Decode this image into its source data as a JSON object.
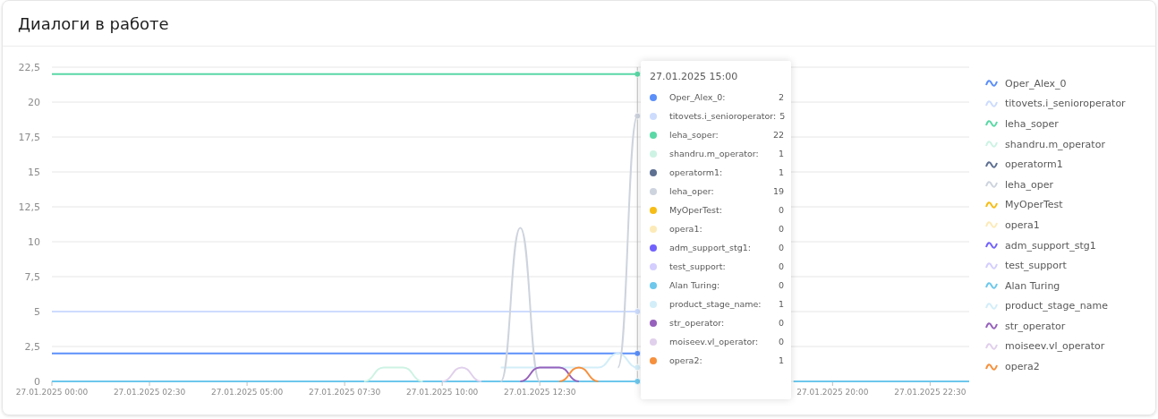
{
  "card": {
    "title": "Диалоги в работе"
  },
  "chart_data": {
    "type": "line",
    "ylim": [
      0,
      22.5
    ],
    "grid": true,
    "legend": true,
    "categories": [
      "27.01.2025 00:00",
      null,
      null,
      null,
      null,
      "27.01.2025 02:30",
      null,
      null,
      null,
      null,
      "27.01.2025 05:00",
      null,
      null,
      null,
      null,
      "27.01.2025 07:30",
      null,
      null,
      null,
      null,
      "27.01.2025 10:00",
      null,
      null,
      null,
      null,
      "27.01.2025 12:30",
      null,
      null,
      null,
      null,
      null,
      null,
      null,
      null,
      null,
      null,
      null,
      null,
      null,
      null,
      "27.01.2025 20:00",
      null,
      null,
      null,
      null,
      "27.01.2025 22:30",
      null,
      null
    ],
    "yticks": [
      {
        "value": 0,
        "label": "0"
      },
      {
        "value": 2.5,
        "label": "2,5"
      },
      {
        "value": 5,
        "label": "5"
      },
      {
        "value": 7.5,
        "label": "7,5"
      },
      {
        "value": 10,
        "label": "10"
      },
      {
        "value": 12.5,
        "label": "12,5"
      },
      {
        "value": 15,
        "label": "15"
      },
      {
        "value": 17.5,
        "label": "17,5"
      },
      {
        "value": 20,
        "label": "20"
      },
      {
        "value": 22.5,
        "label": "22,5"
      }
    ],
    "series": [
      {
        "name": "Oper_Alex_0",
        "color": "#5b8ff9",
        "values": [
          2,
          2,
          2,
          2,
          2,
          2,
          2,
          2,
          2,
          2,
          2,
          2,
          2,
          2,
          2,
          2,
          2,
          2,
          2,
          2,
          2,
          2,
          2,
          2,
          2,
          2,
          2,
          2,
          2,
          2,
          2,
          null,
          null,
          null,
          null,
          null,
          null,
          null,
          null,
          null,
          null,
          null,
          null,
          null,
          null,
          null,
          null,
          null
        ]
      },
      {
        "name": "titovets.i_senioroperator",
        "color": "#cddcfd",
        "values": [
          5,
          5,
          5,
          5,
          5,
          5,
          5,
          5,
          5,
          5,
          5,
          5,
          5,
          5,
          5,
          5,
          5,
          5,
          5,
          5,
          5,
          5,
          5,
          5,
          5,
          5,
          5,
          5,
          5,
          5,
          5,
          null,
          null,
          null,
          null,
          null,
          null,
          null,
          null,
          null,
          null,
          null,
          null,
          null,
          null,
          null,
          null,
          null
        ]
      },
      {
        "name": "leha_soper",
        "color": "#5ad8a6",
        "values": [
          22,
          22,
          22,
          22,
          22,
          22,
          22,
          22,
          22,
          22,
          22,
          22,
          22,
          22,
          22,
          22,
          22,
          22,
          22,
          22,
          22,
          22,
          22,
          22,
          22,
          22,
          22,
          22,
          22,
          22,
          22,
          null,
          null,
          null,
          null,
          null,
          null,
          null,
          null,
          null,
          null,
          null,
          null,
          null,
          null,
          null,
          null,
          null
        ]
      },
      {
        "name": "shandru.m_operator",
        "color": "#cdf3e4",
        "values": [
          null,
          null,
          null,
          null,
          null,
          null,
          null,
          null,
          null,
          null,
          null,
          null,
          null,
          null,
          null,
          null,
          0,
          1,
          1,
          0,
          null,
          null,
          null,
          null,
          null,
          null,
          null,
          null,
          null,
          null,
          null,
          null,
          null,
          null,
          null,
          null,
          null,
          null,
          null,
          null,
          null,
          null,
          null,
          null,
          null,
          null,
          null,
          null
        ]
      },
      {
        "name": "operatorm1",
        "color": "#5d7092",
        "values": [
          null,
          null,
          null,
          null,
          null,
          null,
          null,
          null,
          null,
          null,
          null,
          null,
          null,
          null,
          null,
          null,
          null,
          null,
          null,
          null,
          null,
          null,
          null,
          null,
          null,
          null,
          null,
          null,
          null,
          null,
          null,
          null,
          null,
          null,
          null,
          null,
          null,
          null,
          null,
          null,
          null,
          null,
          null,
          null,
          null,
          null,
          null,
          null
        ]
      },
      {
        "name": "leha_oper",
        "color": "#ced4de",
        "values": [
          null,
          null,
          null,
          null,
          null,
          null,
          null,
          null,
          null,
          null,
          null,
          null,
          null,
          null,
          null,
          null,
          null,
          null,
          null,
          null,
          null,
          null,
          null,
          0,
          11,
          0,
          null,
          null,
          null,
          1,
          19,
          null,
          null,
          null,
          null,
          null,
          null,
          null,
          null,
          null,
          null,
          null,
          null,
          null,
          null,
          null,
          null,
          null
        ]
      },
      {
        "name": "MyOperTest",
        "color": "#f6bd16",
        "values": [
          null,
          null,
          null,
          null,
          null,
          null,
          null,
          null,
          null,
          null,
          null,
          null,
          null,
          null,
          null,
          null,
          null,
          null,
          null,
          null,
          null,
          null,
          null,
          null,
          null,
          null,
          null,
          null,
          null,
          null,
          null,
          null,
          null,
          null,
          null,
          null,
          null,
          null,
          null,
          null,
          null,
          null,
          null,
          null,
          null,
          null,
          null,
          null
        ]
      },
      {
        "name": "opera1",
        "color": "#fcebb9",
        "values": [
          null,
          null,
          null,
          null,
          null,
          null,
          null,
          null,
          null,
          null,
          null,
          null,
          null,
          null,
          null,
          null,
          null,
          null,
          null,
          null,
          null,
          null,
          null,
          null,
          null,
          null,
          null,
          null,
          null,
          null,
          null,
          null,
          null,
          null,
          null,
          null,
          null,
          null,
          null,
          null,
          null,
          null,
          null,
          null,
          null,
          null,
          null,
          null
        ]
      },
      {
        "name": "adm_support_stg1",
        "color": "#7262fd",
        "values": [
          null,
          null,
          null,
          null,
          null,
          null,
          null,
          null,
          null,
          null,
          null,
          null,
          null,
          null,
          null,
          null,
          null,
          null,
          null,
          null,
          null,
          null,
          null,
          null,
          null,
          null,
          null,
          null,
          null,
          null,
          null,
          null,
          null,
          null,
          null,
          null,
          null,
          null,
          null,
          null,
          null,
          null,
          null,
          null,
          null,
          null,
          null,
          null
        ]
      },
      {
        "name": "test_support",
        "color": "#d3cefe",
        "values": [
          null,
          null,
          null,
          null,
          null,
          null,
          null,
          null,
          null,
          null,
          null,
          null,
          null,
          null,
          null,
          null,
          null,
          null,
          null,
          null,
          null,
          null,
          null,
          null,
          null,
          null,
          null,
          null,
          null,
          null,
          null,
          null,
          null,
          null,
          null,
          null,
          null,
          null,
          null,
          null,
          null,
          null,
          null,
          null,
          null,
          null,
          null,
          null
        ]
      },
      {
        "name": "Alan Turing",
        "color": "#6dc8ec",
        "values": [
          0,
          0,
          0,
          0,
          0,
          0,
          0,
          0,
          0,
          0,
          0,
          0,
          0,
          0,
          0,
          0,
          0,
          0,
          0,
          0,
          0,
          0,
          0,
          0,
          0,
          0,
          0,
          0,
          0,
          0,
          0,
          null,
          null,
          null,
          null,
          null,
          null,
          null,
          0,
          0,
          0,
          0,
          0,
          0,
          0,
          0,
          0,
          0
        ]
      },
      {
        "name": "product_stage_name",
        "color": "#d3eef9",
        "values": [
          null,
          null,
          null,
          null,
          null,
          null,
          null,
          null,
          null,
          null,
          null,
          null,
          null,
          null,
          null,
          null,
          null,
          null,
          null,
          null,
          null,
          null,
          null,
          1,
          1,
          1,
          1,
          1,
          1,
          2,
          1,
          null,
          null,
          null,
          null,
          null,
          null,
          null,
          null,
          null,
          null,
          null,
          null,
          null,
          null,
          null,
          null,
          null
        ]
      },
      {
        "name": "str_operator",
        "color": "#9661bc",
        "values": [
          null,
          null,
          null,
          null,
          null,
          null,
          null,
          null,
          null,
          null,
          null,
          null,
          null,
          null,
          null,
          null,
          null,
          null,
          null,
          null,
          null,
          null,
          null,
          null,
          0,
          1,
          1,
          0,
          null,
          null,
          null,
          null,
          null,
          null,
          null,
          null,
          null,
          null,
          null,
          null,
          null,
          null,
          null,
          null,
          null,
          null,
          null,
          null
        ]
      },
      {
        "name": "moiseev.vl_operator",
        "color": "#e0d0ec",
        "values": [
          null,
          null,
          null,
          null,
          null,
          null,
          null,
          null,
          null,
          null,
          null,
          null,
          null,
          null,
          null,
          null,
          null,
          null,
          null,
          null,
          0,
          1,
          0,
          null,
          null,
          null,
          null,
          null,
          null,
          null,
          null,
          null,
          null,
          null,
          null,
          null,
          null,
          null,
          null,
          null,
          null,
          null,
          null,
          null,
          null,
          null,
          null,
          null
        ]
      },
      {
        "name": "opera2",
        "color": "#f6903d",
        "values": [
          null,
          null,
          null,
          null,
          null,
          null,
          null,
          null,
          null,
          null,
          null,
          null,
          null,
          null,
          null,
          null,
          null,
          null,
          null,
          null,
          null,
          null,
          null,
          null,
          null,
          null,
          0,
          1,
          0,
          null,
          null,
          null,
          null,
          null,
          null,
          null,
          null,
          null,
          null,
          null,
          null,
          null,
          null,
          null,
          null,
          null,
          null,
          null
        ]
      }
    ]
  },
  "tooltip": {
    "title": "27.01.2025 15:00",
    "rows": [
      {
        "label": "Oper_Alex_0:",
        "value": "2",
        "color": "#5b8ff9"
      },
      {
        "label": "titovets.i_senioroperator:",
        "value": "5",
        "color": "#cddcfd"
      },
      {
        "label": "leha_soper:",
        "value": "22",
        "color": "#5ad8a6"
      },
      {
        "label": "shandru.m_operator:",
        "value": "1",
        "color": "#cdf3e4"
      },
      {
        "label": "operatorm1:",
        "value": "1",
        "color": "#5d7092"
      },
      {
        "label": "leha_oper:",
        "value": "19",
        "color": "#ced4de"
      },
      {
        "label": "MyOperTest:",
        "value": "0",
        "color": "#f6bd16"
      },
      {
        "label": "opera1:",
        "value": "0",
        "color": "#fcebb9"
      },
      {
        "label": "adm_support_stg1:",
        "value": "0",
        "color": "#7262fd"
      },
      {
        "label": "test_support:",
        "value": "0",
        "color": "#d3cefe"
      },
      {
        "label": "Alan Turing:",
        "value": "0",
        "color": "#6dc8ec"
      },
      {
        "label": "product_stage_name:",
        "value": "1",
        "color": "#d3eef9"
      },
      {
        "label": "str_operator:",
        "value": "0",
        "color": "#9661bc"
      },
      {
        "label": "moiseev.vl_operator:",
        "value": "0",
        "color": "#e0d0ec"
      },
      {
        "label": "opera2:",
        "value": "1",
        "color": "#f6903d"
      }
    ]
  }
}
